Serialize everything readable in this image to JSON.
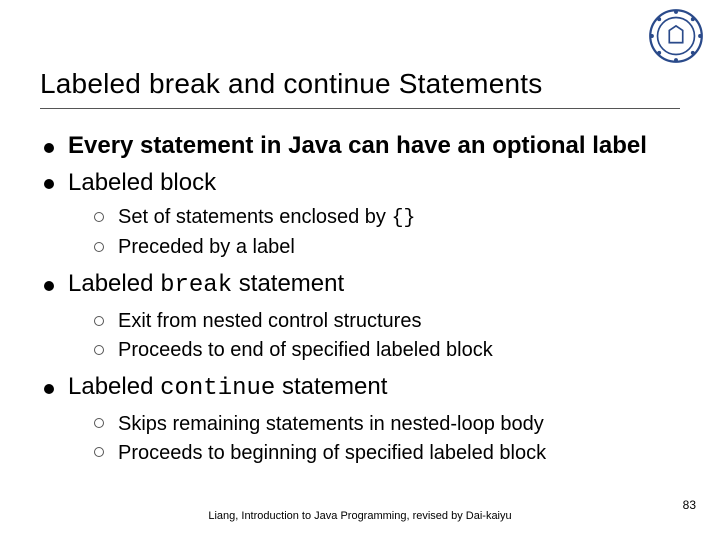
{
  "title": "Labeled break and continue Statements",
  "bullets": [
    {
      "text": "Every statement in Java can have an optional label",
      "bold": true,
      "sub": []
    },
    {
      "text": "Labeled block",
      "sub": [
        {
          "pre": "Set of statements enclosed by ",
          "code": "{}"
        },
        {
          "pre": "Preceded by a label"
        }
      ]
    },
    {
      "pre": "Labeled ",
      "code": "break",
      "post": " statement",
      "sub": [
        {
          "pre": "Exit from nested control structures"
        },
        {
          "pre": "Proceeds to end of specified labeled block"
        }
      ]
    },
    {
      "pre": "Labeled ",
      "code": "continue",
      "post": " statement",
      "sub": [
        {
          "pre": "Skips remaining statements in nested-loop body"
        },
        {
          "pre": "Proceeds to beginning of specified labeled block"
        }
      ]
    }
  ],
  "footer": "Liang, Introduction to Java Programming, revised by Dai-kaiyu",
  "page": "83"
}
